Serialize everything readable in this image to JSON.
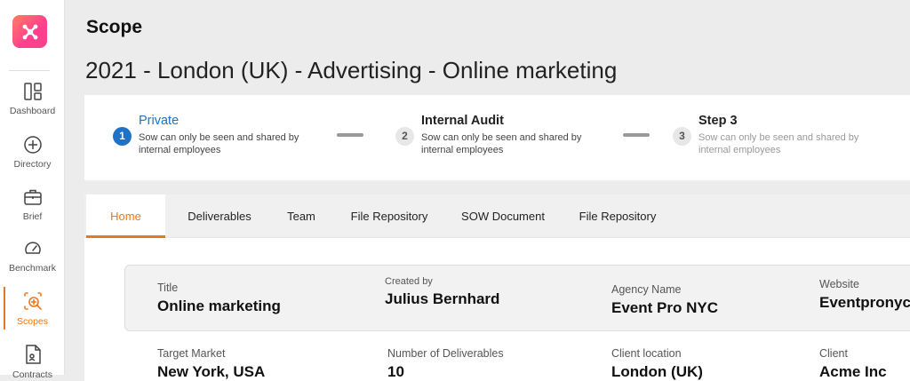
{
  "sidebar": {
    "items": [
      {
        "label": "Dashboard",
        "icon": "dashboard-icon"
      },
      {
        "label": "Directory",
        "icon": "plus-circle-icon"
      },
      {
        "label": "Brief",
        "icon": "briefcase-icon"
      },
      {
        "label": "Benchmark",
        "icon": "gauge-icon"
      },
      {
        "label": "Scopes",
        "icon": "scope-search-icon",
        "active": true
      },
      {
        "label": "Contracts",
        "icon": "contract-icon"
      }
    ]
  },
  "header": {
    "heading": "Scope",
    "title": "2021 - London (UK)  - Advertising - Online marketing"
  },
  "stepper": {
    "steps": [
      {
        "number": "1",
        "title": "Private",
        "description": "Sow can only be seen and shared by internal employees"
      },
      {
        "number": "2",
        "title": "Internal Audit",
        "description": "Sow can only be seen and shared by internal employees"
      },
      {
        "number": "3",
        "title": "Step 3",
        "description": "Sow can only be seen and shared by internal employees"
      }
    ]
  },
  "tabs": [
    {
      "label": "Home"
    },
    {
      "label": "Deliverables"
    },
    {
      "label": "Team"
    },
    {
      "label": "File Repository"
    },
    {
      "label": "SOW Document"
    },
    {
      "label": "File Repository"
    }
  ],
  "details": {
    "title_label": "Title",
    "title_value": "Online marketing",
    "created_label": "Created by",
    "created_value": "Julius Bernhard",
    "agency_label": "Agency Name",
    "agency_value": "Event Pro NYC",
    "website_label": "Website",
    "website_value": "Eventpronyc.",
    "market_label": "Target Market",
    "market_value": "New York, USA",
    "deliverables_label": "Number of Deliverables",
    "deliverables_value": "10",
    "location_label": "Client location",
    "location_value": "London (UK)",
    "client_label": "Client",
    "client_value": "Acme Inc"
  },
  "colors": {
    "accent": "#e9771b",
    "primary": "#1f72c6"
  }
}
